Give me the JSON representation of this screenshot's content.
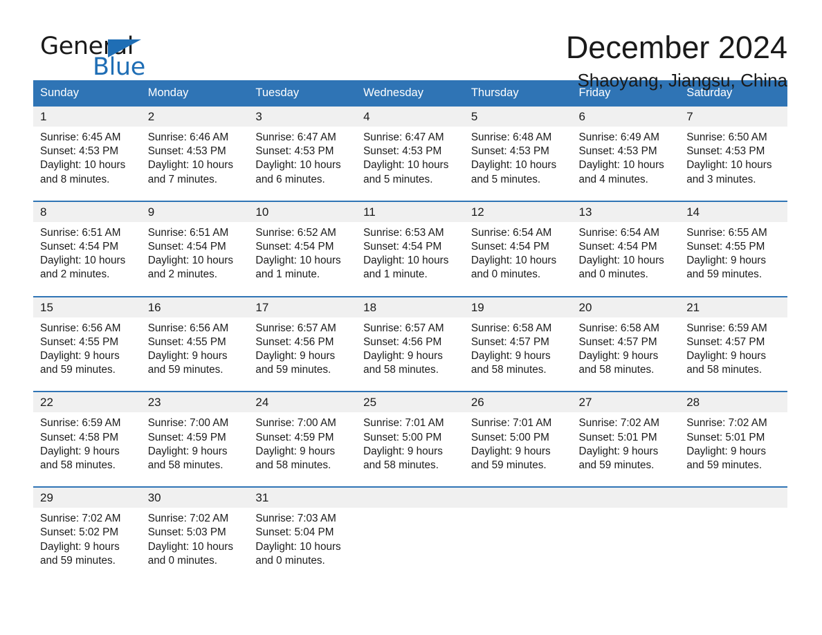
{
  "brand": {
    "name_part1": "General",
    "name_part2": "Blue",
    "triangle_icon": "triangle-icon",
    "accent_color": "#1f6eb5"
  },
  "header": {
    "title": "December 2024",
    "location": "Shaoyang, Jiangsu, China"
  },
  "calendar": {
    "header_bg": "#2f74b5",
    "date_band_bg": "#f0f0f0",
    "weekdays": [
      "Sunday",
      "Monday",
      "Tuesday",
      "Wednesday",
      "Thursday",
      "Friday",
      "Saturday"
    ],
    "weeks": [
      [
        {
          "date": "1",
          "sunrise": "Sunrise: 6:45 AM",
          "sunset": "Sunset: 4:53 PM",
          "daylight_line1": "Daylight: 10 hours",
          "daylight_line2": "and 8 minutes."
        },
        {
          "date": "2",
          "sunrise": "Sunrise: 6:46 AM",
          "sunset": "Sunset: 4:53 PM",
          "daylight_line1": "Daylight: 10 hours",
          "daylight_line2": "and 7 minutes."
        },
        {
          "date": "3",
          "sunrise": "Sunrise: 6:47 AM",
          "sunset": "Sunset: 4:53 PM",
          "daylight_line1": "Daylight: 10 hours",
          "daylight_line2": "and 6 minutes."
        },
        {
          "date": "4",
          "sunrise": "Sunrise: 6:47 AM",
          "sunset": "Sunset: 4:53 PM",
          "daylight_line1": "Daylight: 10 hours",
          "daylight_line2": "and 5 minutes."
        },
        {
          "date": "5",
          "sunrise": "Sunrise: 6:48 AM",
          "sunset": "Sunset: 4:53 PM",
          "daylight_line1": "Daylight: 10 hours",
          "daylight_line2": "and 5 minutes."
        },
        {
          "date": "6",
          "sunrise": "Sunrise: 6:49 AM",
          "sunset": "Sunset: 4:53 PM",
          "daylight_line1": "Daylight: 10 hours",
          "daylight_line2": "and 4 minutes."
        },
        {
          "date": "7",
          "sunrise": "Sunrise: 6:50 AM",
          "sunset": "Sunset: 4:53 PM",
          "daylight_line1": "Daylight: 10 hours",
          "daylight_line2": "and 3 minutes."
        }
      ],
      [
        {
          "date": "8",
          "sunrise": "Sunrise: 6:51 AM",
          "sunset": "Sunset: 4:54 PM",
          "daylight_line1": "Daylight: 10 hours",
          "daylight_line2": "and 2 minutes."
        },
        {
          "date": "9",
          "sunrise": "Sunrise: 6:51 AM",
          "sunset": "Sunset: 4:54 PM",
          "daylight_line1": "Daylight: 10 hours",
          "daylight_line2": "and 2 minutes."
        },
        {
          "date": "10",
          "sunrise": "Sunrise: 6:52 AM",
          "sunset": "Sunset: 4:54 PM",
          "daylight_line1": "Daylight: 10 hours",
          "daylight_line2": "and 1 minute."
        },
        {
          "date": "11",
          "sunrise": "Sunrise: 6:53 AM",
          "sunset": "Sunset: 4:54 PM",
          "daylight_line1": "Daylight: 10 hours",
          "daylight_line2": "and 1 minute."
        },
        {
          "date": "12",
          "sunrise": "Sunrise: 6:54 AM",
          "sunset": "Sunset: 4:54 PM",
          "daylight_line1": "Daylight: 10 hours",
          "daylight_line2": "and 0 minutes."
        },
        {
          "date": "13",
          "sunrise": "Sunrise: 6:54 AM",
          "sunset": "Sunset: 4:54 PM",
          "daylight_line1": "Daylight: 10 hours",
          "daylight_line2": "and 0 minutes."
        },
        {
          "date": "14",
          "sunrise": "Sunrise: 6:55 AM",
          "sunset": "Sunset: 4:55 PM",
          "daylight_line1": "Daylight: 9 hours",
          "daylight_line2": "and 59 minutes."
        }
      ],
      [
        {
          "date": "15",
          "sunrise": "Sunrise: 6:56 AM",
          "sunset": "Sunset: 4:55 PM",
          "daylight_line1": "Daylight: 9 hours",
          "daylight_line2": "and 59 minutes."
        },
        {
          "date": "16",
          "sunrise": "Sunrise: 6:56 AM",
          "sunset": "Sunset: 4:55 PM",
          "daylight_line1": "Daylight: 9 hours",
          "daylight_line2": "and 59 minutes."
        },
        {
          "date": "17",
          "sunrise": "Sunrise: 6:57 AM",
          "sunset": "Sunset: 4:56 PM",
          "daylight_line1": "Daylight: 9 hours",
          "daylight_line2": "and 59 minutes."
        },
        {
          "date": "18",
          "sunrise": "Sunrise: 6:57 AM",
          "sunset": "Sunset: 4:56 PM",
          "daylight_line1": "Daylight: 9 hours",
          "daylight_line2": "and 58 minutes."
        },
        {
          "date": "19",
          "sunrise": "Sunrise: 6:58 AM",
          "sunset": "Sunset: 4:57 PM",
          "daylight_line1": "Daylight: 9 hours",
          "daylight_line2": "and 58 minutes."
        },
        {
          "date": "20",
          "sunrise": "Sunrise: 6:58 AM",
          "sunset": "Sunset: 4:57 PM",
          "daylight_line1": "Daylight: 9 hours",
          "daylight_line2": "and 58 minutes."
        },
        {
          "date": "21",
          "sunrise": "Sunrise: 6:59 AM",
          "sunset": "Sunset: 4:57 PM",
          "daylight_line1": "Daylight: 9 hours",
          "daylight_line2": "and 58 minutes."
        }
      ],
      [
        {
          "date": "22",
          "sunrise": "Sunrise: 6:59 AM",
          "sunset": "Sunset: 4:58 PM",
          "daylight_line1": "Daylight: 9 hours",
          "daylight_line2": "and 58 minutes."
        },
        {
          "date": "23",
          "sunrise": "Sunrise: 7:00 AM",
          "sunset": "Sunset: 4:59 PM",
          "daylight_line1": "Daylight: 9 hours",
          "daylight_line2": "and 58 minutes."
        },
        {
          "date": "24",
          "sunrise": "Sunrise: 7:00 AM",
          "sunset": "Sunset: 4:59 PM",
          "daylight_line1": "Daylight: 9 hours",
          "daylight_line2": "and 58 minutes."
        },
        {
          "date": "25",
          "sunrise": "Sunrise: 7:01 AM",
          "sunset": "Sunset: 5:00 PM",
          "daylight_line1": "Daylight: 9 hours",
          "daylight_line2": "and 58 minutes."
        },
        {
          "date": "26",
          "sunrise": "Sunrise: 7:01 AM",
          "sunset": "Sunset: 5:00 PM",
          "daylight_line1": "Daylight: 9 hours",
          "daylight_line2": "and 59 minutes."
        },
        {
          "date": "27",
          "sunrise": "Sunrise: 7:02 AM",
          "sunset": "Sunset: 5:01 PM",
          "daylight_line1": "Daylight: 9 hours",
          "daylight_line2": "and 59 minutes."
        },
        {
          "date": "28",
          "sunrise": "Sunrise: 7:02 AM",
          "sunset": "Sunset: 5:01 PM",
          "daylight_line1": "Daylight: 9 hours",
          "daylight_line2": "and 59 minutes."
        }
      ],
      [
        {
          "date": "29",
          "sunrise": "Sunrise: 7:02 AM",
          "sunset": "Sunset: 5:02 PM",
          "daylight_line1": "Daylight: 9 hours",
          "daylight_line2": "and 59 minutes."
        },
        {
          "date": "30",
          "sunrise": "Sunrise: 7:02 AM",
          "sunset": "Sunset: 5:03 PM",
          "daylight_line1": "Daylight: 10 hours",
          "daylight_line2": "and 0 minutes."
        },
        {
          "date": "31",
          "sunrise": "Sunrise: 7:03 AM",
          "sunset": "Sunset: 5:04 PM",
          "daylight_line1": "Daylight: 10 hours",
          "daylight_line2": "and 0 minutes."
        },
        {
          "date": "",
          "sunrise": "",
          "sunset": "",
          "daylight_line1": "",
          "daylight_line2": ""
        },
        {
          "date": "",
          "sunrise": "",
          "sunset": "",
          "daylight_line1": "",
          "daylight_line2": ""
        },
        {
          "date": "",
          "sunrise": "",
          "sunset": "",
          "daylight_line1": "",
          "daylight_line2": ""
        },
        {
          "date": "",
          "sunrise": "",
          "sunset": "",
          "daylight_line1": "",
          "daylight_line2": ""
        }
      ]
    ]
  }
}
